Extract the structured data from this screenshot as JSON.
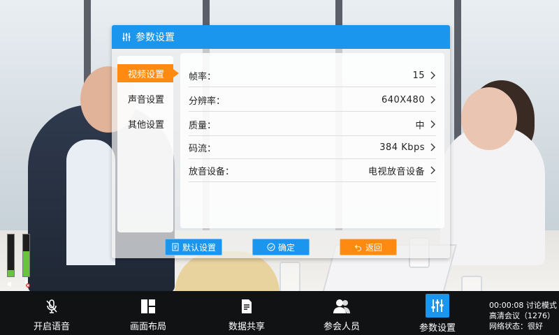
{
  "dialog": {
    "title": "参数设置",
    "sidebar": [
      {
        "label": "视频设置",
        "active": true
      },
      {
        "label": "声音设置",
        "active": false
      },
      {
        "label": "其他设置",
        "active": false
      }
    ],
    "rows": [
      {
        "label": "帧率：",
        "value": "15"
      },
      {
        "label": "分辨率：",
        "value": "640X480"
      },
      {
        "label": "质量：",
        "value": "中"
      },
      {
        "label": "码流：",
        "value": "384 Kbps"
      },
      {
        "label": "放音设备：",
        "value": "电视放音设备"
      }
    ],
    "buttons": {
      "default": "默认设置",
      "confirm": "确定",
      "back": "返回"
    }
  },
  "toolbar": {
    "items": [
      {
        "label": "开启语音",
        "icon": "mic-muted-icon"
      },
      {
        "label": "画面布局",
        "icon": "layout-icon"
      },
      {
        "label": "数据共享",
        "icon": "document-share-icon"
      },
      {
        "label": "参会人员",
        "icon": "users-icon"
      },
      {
        "label": "参数设置",
        "icon": "sliders-icon"
      }
    ],
    "status": {
      "line1": "00:00:08 讨论模式",
      "line2": "高清会议（1276）",
      "line3": "网络状态：很好"
    }
  },
  "meter": {
    "left_level": 0.15,
    "right_level": 0.6
  },
  "colors": {
    "accent_blue": "#1a96ee",
    "accent_orange": "#ff8a12",
    "toolbar_bg": "#101214"
  }
}
